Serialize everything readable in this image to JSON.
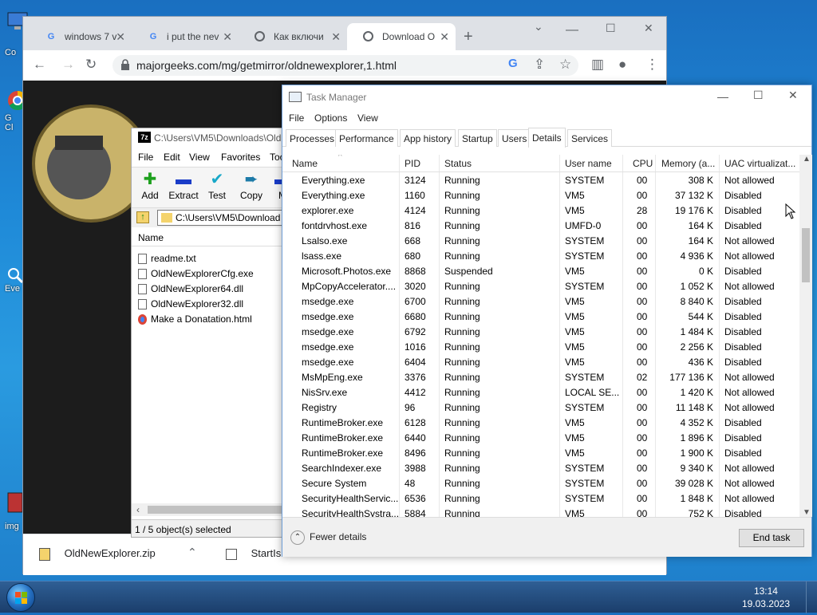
{
  "desktop": {
    "icons": [
      {
        "label": "Co",
        "icon": "computer-icon"
      },
      {
        "label": "G\nCl",
        "icon": "chrome-icon"
      },
      {
        "label": "Eve",
        "icon": "everything-icon"
      },
      {
        "label": "img",
        "icon": "image-icon"
      }
    ]
  },
  "browser": {
    "tabs": [
      {
        "label": "windows 7 v",
        "icon": "google-icon"
      },
      {
        "label": "i put the nev",
        "icon": "google-icon"
      },
      {
        "label": "Как включи",
        "icon": "web-icon"
      },
      {
        "label": "Download O",
        "icon": "web-icon",
        "active": true
      }
    ],
    "url": "majorgeeks.com/mg/getmirror/oldnewexplorer,1.html",
    "downloads": [
      {
        "label": "OldNewExplorer.zip"
      },
      {
        "label": "StartIsB"
      }
    ],
    "accent": "#1a73e8"
  },
  "sevenzip": {
    "title": "C:\\Users\\VM5\\Downloads\\Old",
    "menu": [
      "File",
      "Edit",
      "View",
      "Favorites",
      "Too"
    ],
    "tools": [
      {
        "label": "Add",
        "icon": "plus-icon",
        "color": "#1ea01e"
      },
      {
        "label": "Extract",
        "icon": "minus-icon",
        "color": "#1a3cc8"
      },
      {
        "label": "Test",
        "icon": "check-icon",
        "color": "#18a8c8"
      },
      {
        "label": "Copy",
        "icon": "arrow-right-icon",
        "color": "#1c7aa8"
      },
      {
        "label": "M",
        "icon": "move-icon",
        "color": "#1a3cc8"
      }
    ],
    "path": "C:\\Users\\VM5\\Download",
    "column_name": "Name",
    "files": [
      {
        "name": "readme.txt"
      },
      {
        "name": "OldNewExplorerCfg.exe"
      },
      {
        "name": "OldNewExplorer64.dll"
      },
      {
        "name": "OldNewExplorer32.dll"
      },
      {
        "name": "Make a Donatation.html"
      }
    ],
    "status": "1 / 5 object(s) selected"
  },
  "taskmgr": {
    "title": "Task Manager",
    "menu": [
      "File",
      "Options",
      "View"
    ],
    "tabs": [
      "Processes",
      "Performance",
      "App history",
      "Startup",
      "Users",
      "Details",
      "Services"
    ],
    "active_tab": "Details",
    "columns": [
      "Name",
      "PID",
      "Status",
      "User name",
      "CPU",
      "Memory (a...",
      "UAC virtualizat..."
    ],
    "rows": [
      {
        "name": "Everything.exe",
        "pid": "3124",
        "status": "Running",
        "user": "SYSTEM",
        "cpu": "00",
        "mem": "308 K",
        "uac": "Not allowed",
        "icon": "search-icon"
      },
      {
        "name": "Everything.exe",
        "pid": "1160",
        "status": "Running",
        "user": "VM5",
        "cpu": "00",
        "mem": "37 132 K",
        "uac": "Disabled",
        "icon": "search-icon"
      },
      {
        "name": "explorer.exe",
        "pid": "4124",
        "status": "Running",
        "user": "VM5",
        "cpu": "28",
        "mem": "19 176 K",
        "uac": "Disabled",
        "icon": "folder-icon"
      },
      {
        "name": "fontdrvhost.exe",
        "pid": "816",
        "status": "Running",
        "user": "UMFD-0",
        "cpu": "00",
        "mem": "164 K",
        "uac": "Disabled",
        "icon": "app-icon"
      },
      {
        "name": "Lsalso.exe",
        "pid": "668",
        "status": "Running",
        "user": "SYSTEM",
        "cpu": "00",
        "mem": "164 K",
        "uac": "Not allowed",
        "icon": "app-icon"
      },
      {
        "name": "lsass.exe",
        "pid": "680",
        "status": "Running",
        "user": "SYSTEM",
        "cpu": "00",
        "mem": "4 936 K",
        "uac": "Not allowed",
        "icon": "app-icon"
      },
      {
        "name": "Microsoft.Photos.exe",
        "pid": "8868",
        "status": "Suspended",
        "user": "VM5",
        "cpu": "00",
        "mem": "0 K",
        "uac": "Disabled",
        "icon": "app-icon"
      },
      {
        "name": "MpCopyAccelerator....",
        "pid": "3020",
        "status": "Running",
        "user": "SYSTEM",
        "cpu": "00",
        "mem": "1 052 K",
        "uac": "Not allowed",
        "icon": "shield-icon"
      },
      {
        "name": "msedge.exe",
        "pid": "6700",
        "status": "Running",
        "user": "VM5",
        "cpu": "00",
        "mem": "8 840 K",
        "uac": "Disabled",
        "icon": "edge-icon"
      },
      {
        "name": "msedge.exe",
        "pid": "6680",
        "status": "Running",
        "user": "VM5",
        "cpu": "00",
        "mem": "544 K",
        "uac": "Disabled",
        "icon": "edge-icon"
      },
      {
        "name": "msedge.exe",
        "pid": "6792",
        "status": "Running",
        "user": "VM5",
        "cpu": "00",
        "mem": "1 484 K",
        "uac": "Disabled",
        "icon": "edge-icon"
      },
      {
        "name": "msedge.exe",
        "pid": "1016",
        "status": "Running",
        "user": "VM5",
        "cpu": "00",
        "mem": "2 256 K",
        "uac": "Disabled",
        "icon": "edge-icon"
      },
      {
        "name": "msedge.exe",
        "pid": "6404",
        "status": "Running",
        "user": "VM5",
        "cpu": "00",
        "mem": "436 K",
        "uac": "Disabled",
        "icon": "edge-icon"
      },
      {
        "name": "MsMpEng.exe",
        "pid": "3376",
        "status": "Running",
        "user": "SYSTEM",
        "cpu": "02",
        "mem": "177 136 K",
        "uac": "Not allowed",
        "icon": "app-icon"
      },
      {
        "name": "NisSrv.exe",
        "pid": "4412",
        "status": "Running",
        "user": "LOCAL SE...",
        "cpu": "00",
        "mem": "1 420 K",
        "uac": "Not allowed",
        "icon": "app-icon"
      },
      {
        "name": "Registry",
        "pid": "96",
        "status": "Running",
        "user": "SYSTEM",
        "cpu": "00",
        "mem": "11 148 K",
        "uac": "Not allowed",
        "icon": "app-icon"
      },
      {
        "name": "RuntimeBroker.exe",
        "pid": "6128",
        "status": "Running",
        "user": "VM5",
        "cpu": "00",
        "mem": "4 352 K",
        "uac": "Disabled",
        "icon": "app-icon"
      },
      {
        "name": "RuntimeBroker.exe",
        "pid": "6440",
        "status": "Running",
        "user": "VM5",
        "cpu": "00",
        "mem": "1 896 K",
        "uac": "Disabled",
        "icon": "app-icon"
      },
      {
        "name": "RuntimeBroker.exe",
        "pid": "8496",
        "status": "Running",
        "user": "VM5",
        "cpu": "00",
        "mem": "1 900 K",
        "uac": "Disabled",
        "icon": "app-icon"
      },
      {
        "name": "SearchIndexer.exe",
        "pid": "3988",
        "status": "Running",
        "user": "SYSTEM",
        "cpu": "00",
        "mem": "9 340 K",
        "uac": "Not allowed",
        "icon": "search-app-icon"
      },
      {
        "name": "Secure System",
        "pid": "48",
        "status": "Running",
        "user": "SYSTEM",
        "cpu": "00",
        "mem": "39 028 K",
        "uac": "Not allowed",
        "icon": "app-icon"
      },
      {
        "name": "SecurityHealthServic...",
        "pid": "6536",
        "status": "Running",
        "user": "SYSTEM",
        "cpu": "00",
        "mem": "1 848 K",
        "uac": "Not allowed",
        "icon": "app-icon"
      },
      {
        "name": "SecurityHealthSystra...",
        "pid": "5884",
        "status": "Running",
        "user": "VM5",
        "cpu": "00",
        "mem": "752 K",
        "uac": "Disabled",
        "icon": "shield-icon"
      }
    ],
    "fewer_details": "Fewer details",
    "end_task": "End task"
  },
  "taskbar": {
    "time": "13:14",
    "date": "19.03.2023"
  }
}
